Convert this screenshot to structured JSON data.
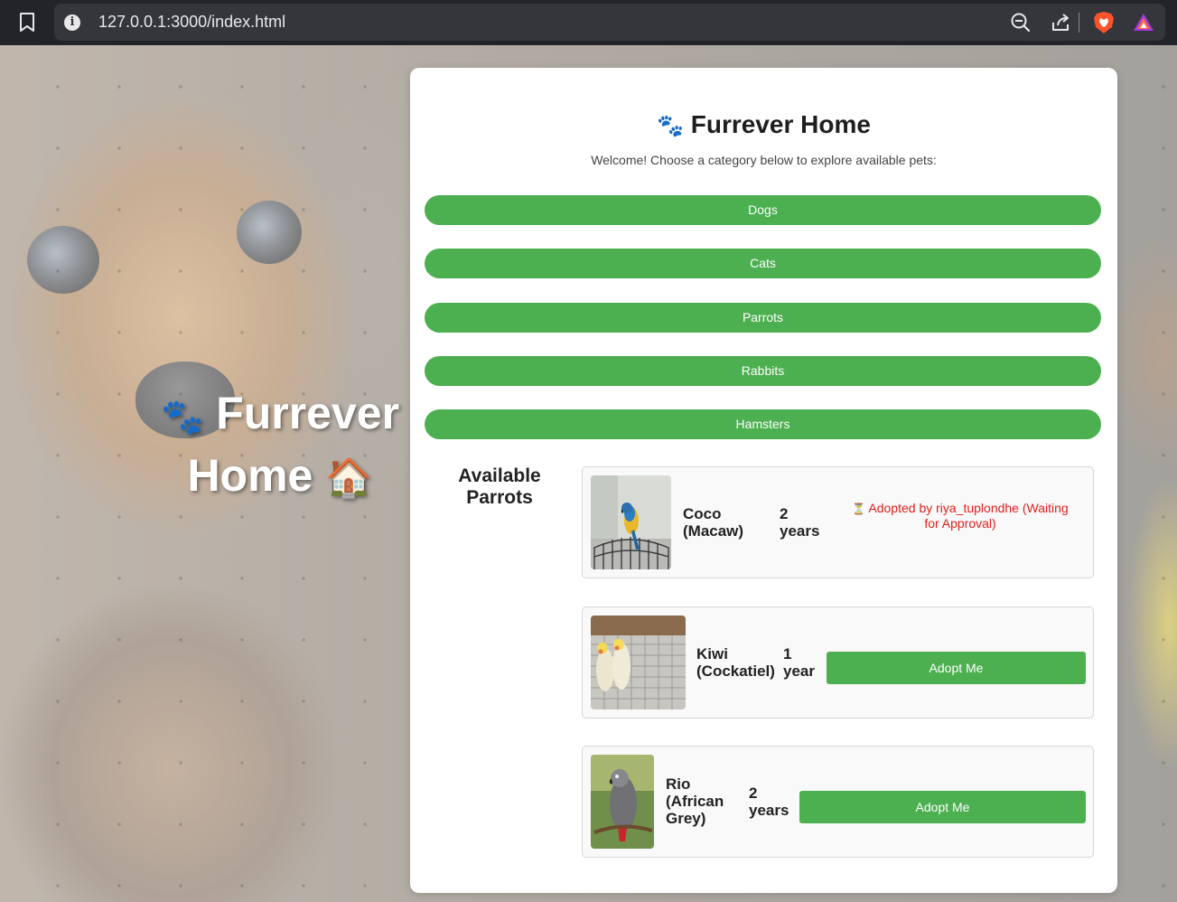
{
  "browser": {
    "url": "127.0.0.1:3000/index.html",
    "icons": [
      "bookmark-icon",
      "site-info-icon",
      "zoom-out-icon",
      "share-icon",
      "brave-shield-icon",
      "brave-rewards-icon"
    ]
  },
  "hero": {
    "paws": "🐾",
    "title_line1": "Furrever",
    "title_line2": "Home",
    "house": "🏠"
  },
  "header": {
    "paws": "🐾",
    "title": "Furrever Home",
    "subtitle": "Welcome! Choose a category below to explore available pets:"
  },
  "categories": [
    "Dogs",
    "Cats",
    "Parrots",
    "Rabbits",
    "Hamsters"
  ],
  "section": {
    "title_line1": "Available",
    "title_line2": "Parrots"
  },
  "pets": [
    {
      "name_line1": "Coco",
      "name_line2": "(Macaw)",
      "age_line1": "2",
      "age_line2": "years",
      "status_icon": "⏳",
      "status_text": "Adopted by riya_tuplondhe (Waiting for Approval)"
    },
    {
      "name_line1": "Kiwi",
      "name_line2": "(Cockatiel)",
      "age_line1": "1",
      "age_line2": "year",
      "button": "Adopt Me"
    },
    {
      "name_line1": "Rio",
      "name_line2": "(African",
      "name_line3": "Grey)",
      "age_line1": "2",
      "age_line2": "years",
      "button": "Adopt Me"
    }
  ],
  "colors": {
    "primary_green": "#4caf50",
    "status_red": "#e0201c",
    "card_bg": "#ffffff"
  }
}
